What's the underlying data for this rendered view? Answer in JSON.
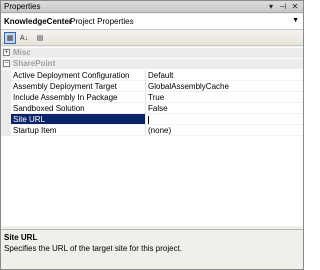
{
  "titlebar": {
    "title": "Properties",
    "icons": [
      "pin-icon",
      "close-icon"
    ]
  },
  "object_selector": {
    "name": "KnowledgeCenter",
    "type": "Project Properties"
  },
  "toolbar": {
    "tools": [
      "categorized-icon",
      "alphabetical-icon",
      "property-pages-icon"
    ]
  },
  "categories": [
    {
      "label": "Misc",
      "expanded": false
    },
    {
      "label": "SharePoint",
      "expanded": true
    }
  ],
  "properties": [
    {
      "name": "Active Deployment Configuration",
      "value": "Default"
    },
    {
      "name": "Assembly Deployment Target",
      "value": "GlobalAssemblyCache"
    },
    {
      "name": "Include Assembly In Package",
      "value": "True"
    },
    {
      "name": "Sandboxed Solution",
      "value": "False"
    },
    {
      "name": "Site URL",
      "value": ""
    },
    {
      "name": "Startup Item",
      "value": "(none)"
    }
  ],
  "selected_property": "Site URL",
  "description": {
    "title": "Site URL",
    "text": "Specifies the URL of the target site for this project."
  }
}
